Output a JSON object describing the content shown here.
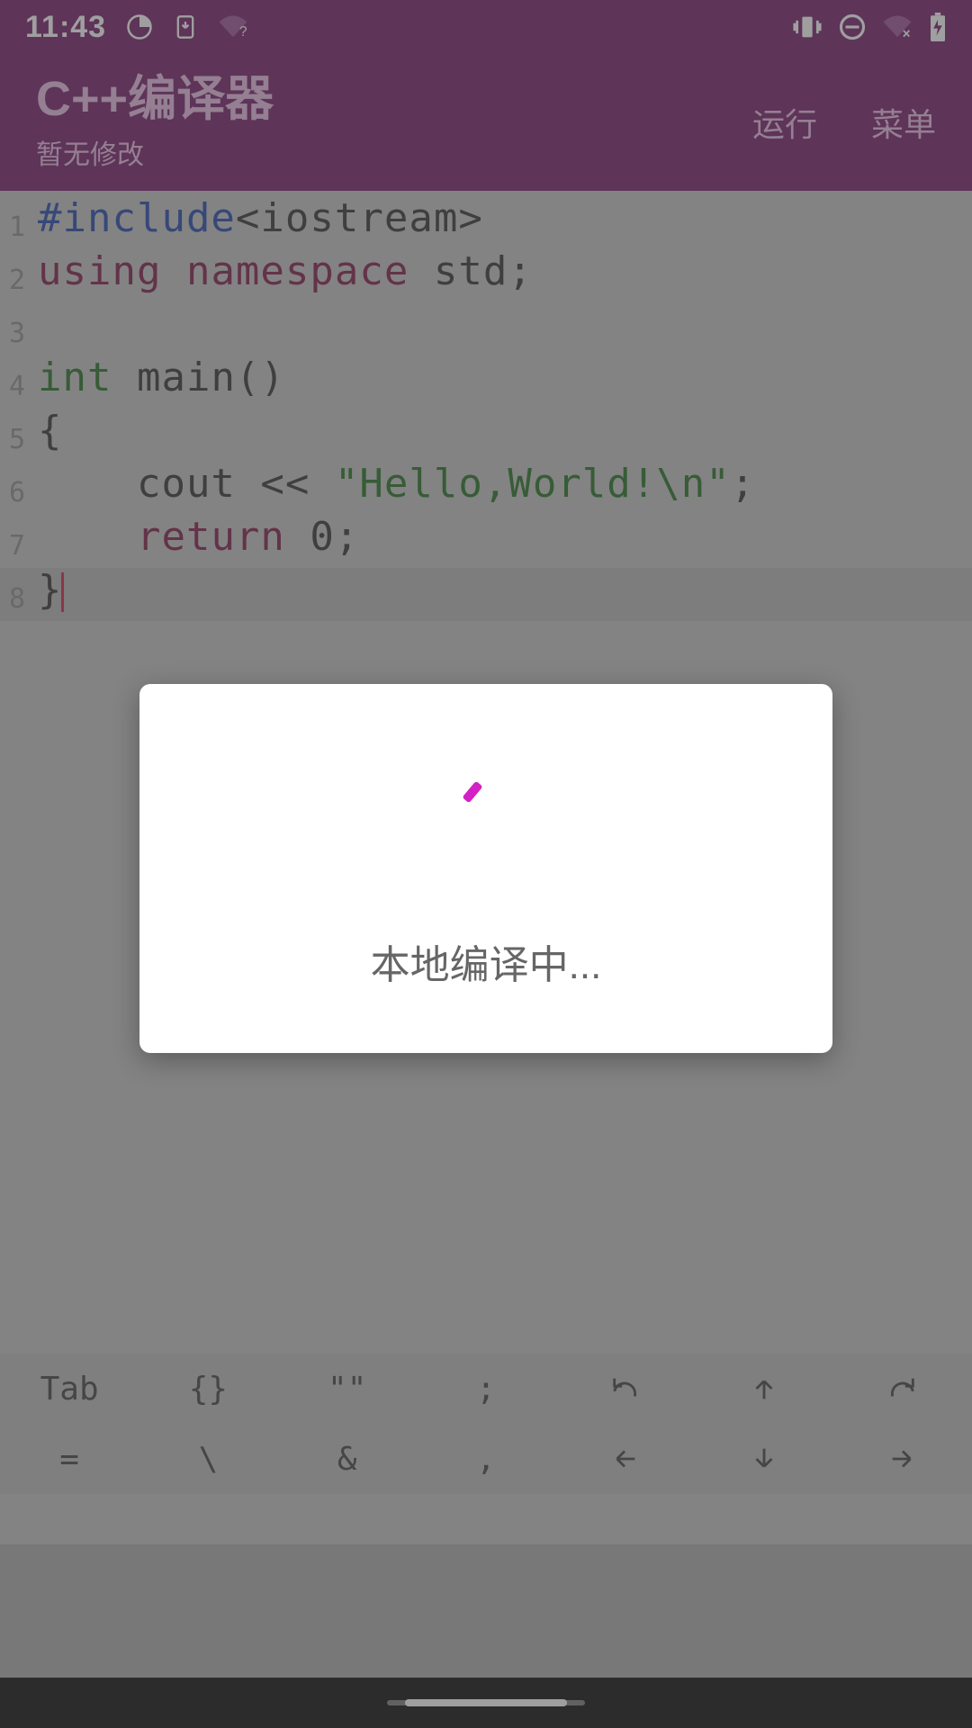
{
  "status": {
    "time": "11:43",
    "icons_left": [
      "clock-progress-icon",
      "download-icon",
      "wifi-question-icon"
    ],
    "icons_right": [
      "vibrate-icon",
      "dnd-icon",
      "wifi-off-icon",
      "battery-charging-icon"
    ]
  },
  "header": {
    "title": "C++编译器",
    "subtitle": "暂无修改",
    "run_label": "运行",
    "menu_label": "菜单"
  },
  "editor": {
    "highlight_line": 8,
    "lines": [
      {
        "n": 1,
        "tokens": [
          [
            "kw-include",
            "#include"
          ],
          [
            "plain",
            "<iostream>"
          ]
        ]
      },
      {
        "n": 2,
        "tokens": [
          [
            "kw-using",
            "using "
          ],
          [
            "kw-ns",
            "namespace"
          ],
          [
            "plain",
            " std;"
          ]
        ]
      },
      {
        "n": 3,
        "tokens": []
      },
      {
        "n": 4,
        "tokens": [
          [
            "kw-int",
            "int"
          ],
          [
            "plain",
            " main()"
          ]
        ]
      },
      {
        "n": 5,
        "tokens": [
          [
            "plain",
            "{"
          ]
        ]
      },
      {
        "n": 6,
        "tokens": [
          [
            "plain",
            "    cout << "
          ],
          [
            "str",
            "\"Hello,World!\\n\""
          ],
          [
            "plain",
            ";"
          ]
        ]
      },
      {
        "n": 7,
        "tokens": [
          [
            "plain",
            "    "
          ],
          [
            "kw-ret",
            "return"
          ],
          [
            "plain",
            " 0;"
          ]
        ]
      },
      {
        "n": 8,
        "tokens": [
          [
            "plain",
            "}"
          ]
        ],
        "cursor_after": true
      }
    ]
  },
  "keys": {
    "row1": [
      "Tab",
      "{}",
      "\"\"",
      ";",
      "undo-icon",
      "arrow-up-icon",
      "redo-icon"
    ],
    "row2": [
      "=",
      "\\",
      "&",
      ",",
      "arrow-left-icon",
      "arrow-down-icon",
      "arrow-right-icon"
    ]
  },
  "dialog": {
    "text": "本地编译中..."
  }
}
